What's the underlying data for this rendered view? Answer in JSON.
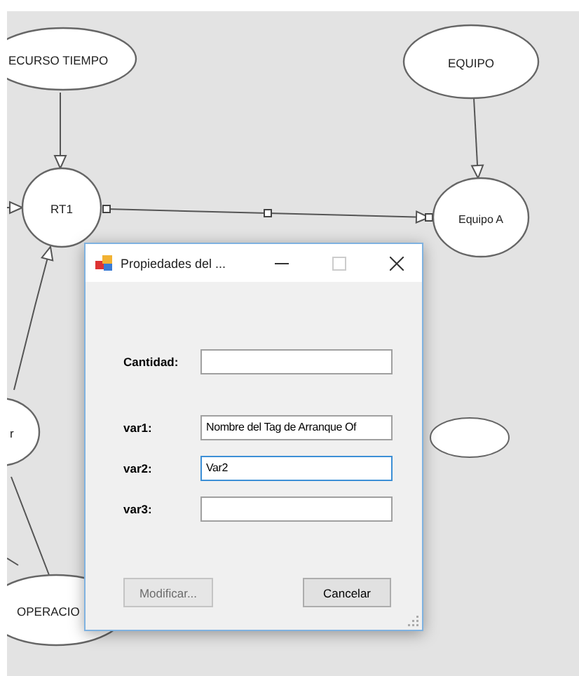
{
  "canvas": {
    "nodes": [
      {
        "label": "ECURSO TIEMPO"
      },
      {
        "label": "EQUIPO"
      },
      {
        "label": "RT1"
      },
      {
        "label": "Equipo A"
      },
      {
        "label": "r"
      },
      {
        "label": "OPERACIO"
      }
    ]
  },
  "dialog": {
    "title": "Propiedades del ...",
    "fields": [
      {
        "label": "Cantidad:",
        "focused": false
      },
      {
        "label": "var1:",
        "value": "Nombre del Tag de Arranque Of",
        "focused": false
      },
      {
        "label": "var2:",
        "value": "Var2",
        "focused": true
      },
      {
        "label": "var3:",
        "focused": false
      }
    ],
    "buttons": [
      {
        "label": "Modificar...",
        "disabled": true
      },
      {
        "label": "Cancelar",
        "disabled": false
      }
    ]
  }
}
